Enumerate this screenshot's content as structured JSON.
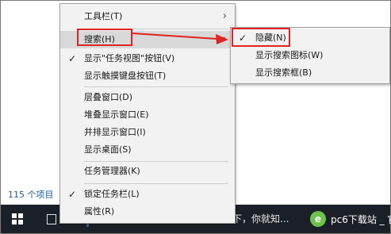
{
  "status_bar": {
    "item_count": "115 个项目"
  },
  "context_menu": {
    "items": [
      {
        "label": "工具栏(T)",
        "has_submenu": true
      },
      {
        "label": "搜索(H)",
        "has_submenu": true,
        "highlighted": true
      },
      {
        "label": "显示\"任务视图\"按钮(V)",
        "checked": true
      },
      {
        "label": "显示触摸键盘按钮(T)"
      },
      {
        "label": "层叠窗口(D)"
      },
      {
        "label": "堆叠显示窗口(E)"
      },
      {
        "label": "并排显示窗口(I)"
      },
      {
        "label": "显示桌面(S)"
      },
      {
        "label": "任务管理器(K)"
      },
      {
        "label": "锁定任务栏(L)",
        "checked": true
      },
      {
        "label": "属性(R)"
      }
    ],
    "check_glyph": "✓",
    "chevron_glyph": "›"
  },
  "search_submenu": {
    "items": [
      {
        "label": "隐藏(N)",
        "checked": true
      },
      {
        "label": "显示搜索图标(W)"
      },
      {
        "label": "显示搜索框(B)"
      }
    ]
  },
  "taskbar": {
    "window_text": "下，你就知...",
    "app_label": "pc6下载站 _ 官",
    "app_icon_glyph": "e",
    "icons": [
      "windows-logo-icon",
      "task-view-icon",
      "pinned-app-icon",
      "pc6-app-icon"
    ]
  },
  "annotation_color": "#e32222"
}
